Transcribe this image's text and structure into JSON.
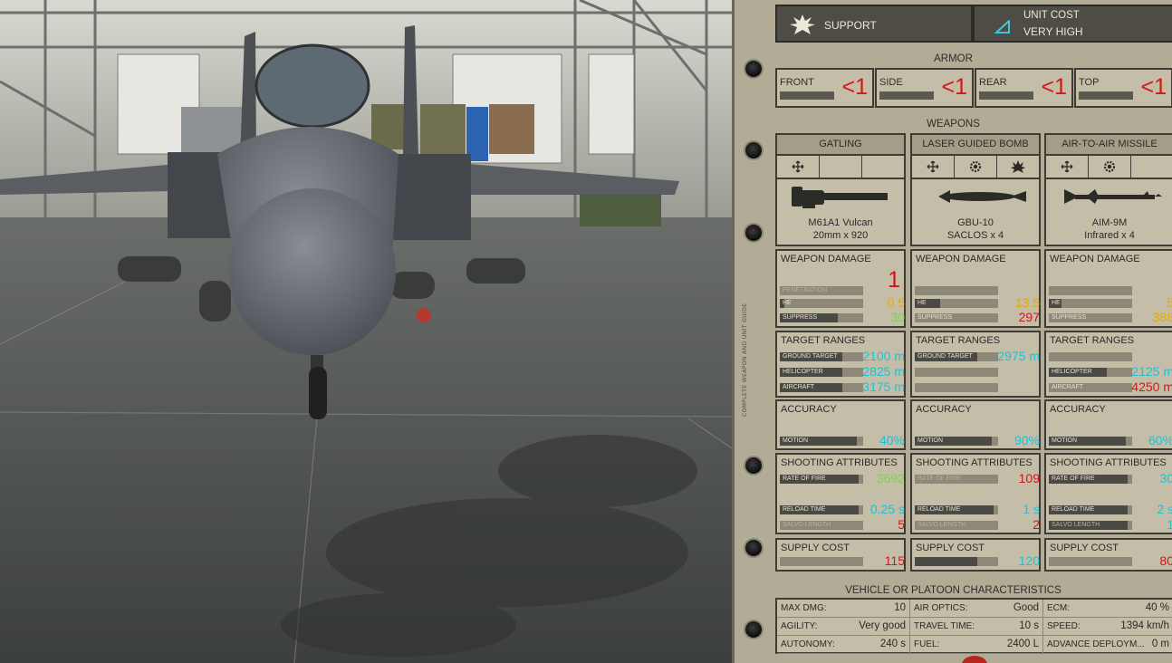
{
  "header": {
    "type_label": "SUPPORT",
    "cost_label": "UNIT COST",
    "cost_value": "VERY HIGH"
  },
  "side_caption": "COMPLETE WEAPON AND UNIT GUIDE",
  "armor": {
    "title": "ARMOR",
    "items": [
      {
        "label": "FRONT",
        "value": "<1"
      },
      {
        "label": "SIDE",
        "value": "<1"
      },
      {
        "label": "REAR",
        "value": "<1"
      },
      {
        "label": "TOP",
        "value": "<1"
      }
    ]
  },
  "weapons_title": "WEAPONS",
  "weapons": [
    {
      "title": "GATLING",
      "name": "M61A1 Vulcan",
      "ammo": "20mm x 920",
      "icons": [
        "move-icon",
        "",
        ""
      ],
      "damage": {
        "title": "WEAPON DAMAGE",
        "main_value": "1",
        "rows": [
          {
            "label": "PENETRATION",
            "value": "",
            "fill": 0.0,
            "color": "c-red"
          },
          {
            "label": "HE",
            "value": "0.5",
            "fill": 0.05,
            "color": "c-yel"
          },
          {
            "label": "SUPPRESS",
            "value": "30",
            "fill": 0.7,
            "color": "c-grn"
          }
        ]
      },
      "ranges": {
        "title": "TARGET RANGES",
        "rows": [
          {
            "label": "GROUND TARGET",
            "value": "2100 m",
            "fill": 0.75,
            "color": "c-cyan"
          },
          {
            "label": "HELICOPTER",
            "value": "2825 m",
            "fill": 0.75,
            "color": "c-cyan"
          },
          {
            "label": "AIRCRAFT",
            "value": "3175 m",
            "fill": 0.75,
            "color": "c-cyan"
          }
        ]
      },
      "accuracy": {
        "title": "ACCURACY",
        "label": "MOTION",
        "value": "40%",
        "fill": 0.92,
        "color": "c-cyan"
      },
      "shooting": {
        "title": "SHOOTING ATTRIBUTES",
        "rows": [
          {
            "label": "RATE OF FIRE",
            "value": "3692",
            "fill": 0.95,
            "color": "c-grn"
          },
          {
            "label": "RELOAD TIME",
            "value": "0.25 s",
            "fill": 0.95,
            "color": "c-cyan"
          },
          {
            "label": "SALVO LENGTH",
            "value": "5",
            "fill": 0.0,
            "color": "c-red"
          }
        ]
      },
      "supply": {
        "title": "SUPPLY COST",
        "value": "115",
        "fill": 0.0,
        "color": "c-red"
      }
    },
    {
      "title": "LASER GUIDED BOMB",
      "name": "GBU-10",
      "ammo": "SACLOS x 4",
      "icons": [
        "move-icon",
        "gear-icon",
        "explosion-icon"
      ],
      "damage": {
        "title": "WEAPON DAMAGE",
        "main_value": "",
        "rows": [
          {
            "label": "",
            "value": "",
            "fill": 0.0,
            "color": "c-red"
          },
          {
            "label": "HE",
            "value": "13.5",
            "fill": 0.3,
            "color": "c-yel"
          },
          {
            "label": "SUPPRESS",
            "value": "297",
            "fill": 0.0,
            "color": "c-red"
          }
        ]
      },
      "ranges": {
        "title": "TARGET RANGES",
        "rows": [
          {
            "label": "GROUND TARGET",
            "value": "2975 m",
            "fill": 0.75,
            "color": "c-cyan"
          },
          {
            "label": "",
            "value": "",
            "fill": 0.0,
            "color": "c-cyan"
          },
          {
            "label": "",
            "value": "",
            "fill": 0.0,
            "color": "c-cyan"
          }
        ]
      },
      "accuracy": {
        "title": "ACCURACY",
        "label": "MOTION",
        "value": "90%",
        "fill": 0.92,
        "color": "c-cyan"
      },
      "shooting": {
        "title": "SHOOTING ATTRIBUTES",
        "rows": [
          {
            "label": "RATE OF FIRE",
            "value": "109",
            "fill": 0.0,
            "color": "c-red"
          },
          {
            "label": "RELOAD TIME",
            "value": "1 s",
            "fill": 0.95,
            "color": "c-cyan"
          },
          {
            "label": "SALVO LENGTH",
            "value": "2",
            "fill": 0.0,
            "color": "c-red"
          }
        ]
      },
      "supply": {
        "title": "SUPPLY COST",
        "value": "120",
        "fill": 0.75,
        "color": "c-cyan"
      }
    },
    {
      "title": "AIR-TO-AIR MISSILE",
      "name": "AIM-9M",
      "ammo": "Infrared x 4",
      "icons": [
        "move-icon",
        "gear-icon",
        ""
      ],
      "damage": {
        "title": "WEAPON DAMAGE",
        "main_value": "",
        "rows": [
          {
            "label": "",
            "value": "",
            "fill": 0.0,
            "color": "c-red"
          },
          {
            "label": "HE",
            "value": "5",
            "fill": 0.15,
            "color": "c-yel"
          },
          {
            "label": "SUPPRESS",
            "value": "388",
            "fill": 0.0,
            "color": "c-yel"
          }
        ]
      },
      "ranges": {
        "title": "TARGET RANGES",
        "rows": [
          {
            "label": "",
            "value": "",
            "fill": 0.0,
            "color": "c-cyan"
          },
          {
            "label": "HELICOPTER",
            "value": "2125 m",
            "fill": 0.7,
            "color": "c-cyan"
          },
          {
            "label": "AIRCRAFT",
            "value": "4250 m",
            "fill": 0.0,
            "color": "c-red"
          }
        ]
      },
      "accuracy": {
        "title": "ACCURACY",
        "label": "MOTION",
        "value": "60%",
        "fill": 0.92,
        "color": "c-cyan"
      },
      "shooting": {
        "title": "SHOOTING ATTRIBUTES",
        "rows": [
          {
            "label": "RATE OF FIRE",
            "value": "30",
            "fill": 0.95,
            "color": "c-cyan"
          },
          {
            "label": "RELOAD TIME",
            "value": "2 s",
            "fill": 0.95,
            "color": "c-cyan"
          },
          {
            "label": "SALVO LENGTH",
            "value": "1",
            "fill": 0.95,
            "color": "c-cyan"
          }
        ]
      },
      "supply": {
        "title": "SUPPLY COST",
        "value": "80",
        "fill": 0.0,
        "color": "c-red"
      }
    }
  ],
  "characteristics": {
    "title": "VEHICLE OR PLATOON CHARACTERISTICS",
    "rows": [
      [
        {
          "key": "MAX DMG:",
          "value": "10",
          "color": "plain"
        },
        {
          "key": "AIR OPTICS:",
          "value": "Good",
          "color": "c-grn"
        },
        {
          "key": "ECM:",
          "value": "40 %",
          "color": "plain"
        }
      ],
      [
        {
          "key": "AGILITY:",
          "value": "Very good",
          "color": "c-cyan"
        },
        {
          "key": "TRAVEL TIME:",
          "value": "10 s",
          "color": "plain"
        },
        {
          "key": "SPEED:",
          "value": "1394 km/h",
          "color": "plain"
        }
      ],
      [
        {
          "key": "AUTONOMY:",
          "value": "240 s",
          "color": "plain"
        },
        {
          "key": "FUEL:",
          "value": "2400 L",
          "color": "plain"
        },
        {
          "key": "ADVANCE DEPLOYM...",
          "value": "0 m",
          "color": "plain"
        }
      ]
    ]
  },
  "colors": {
    "card_bg": "#b2ab95",
    "red": "#cf1616",
    "yellow": "#e9a806",
    "green": "#7fd24c",
    "cyan": "#1bc2d8"
  }
}
